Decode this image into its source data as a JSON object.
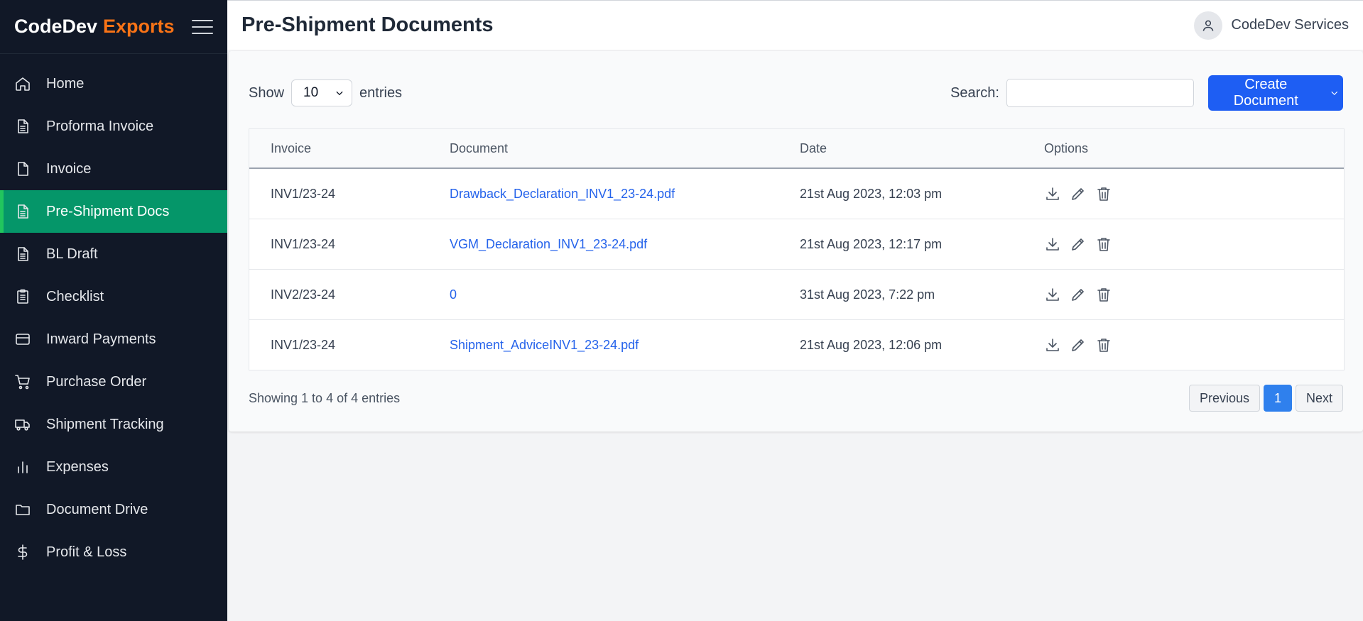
{
  "brand": {
    "name": "CodeDev",
    "accent": "Exports"
  },
  "sidebar": {
    "items": [
      {
        "label": "Home",
        "icon": "home-icon"
      },
      {
        "label": "Proforma Invoice",
        "icon": "document-text-icon"
      },
      {
        "label": "Invoice",
        "icon": "document-icon"
      },
      {
        "label": "Pre-Shipment Docs",
        "icon": "document-text-icon",
        "active": true
      },
      {
        "label": "BL Draft",
        "icon": "document-text-icon"
      },
      {
        "label": "Checklist",
        "icon": "clipboard-icon"
      },
      {
        "label": "Inward Payments",
        "icon": "credit-card-icon"
      },
      {
        "label": "Purchase Order",
        "icon": "cart-icon"
      },
      {
        "label": "Shipment Tracking",
        "icon": "truck-icon"
      },
      {
        "label": "Expenses",
        "icon": "bar-chart-icon"
      },
      {
        "label": "Document Drive",
        "icon": "folder-icon"
      },
      {
        "label": "Profit & Loss",
        "icon": "dollar-icon"
      }
    ]
  },
  "header": {
    "title": "Pre-Shipment Documents",
    "user": "CodeDev Services"
  },
  "toolbar": {
    "show_label": "Show",
    "entries_value": "10",
    "entries_label": "entries",
    "search_label": "Search:",
    "search_value": "",
    "create_label": "Create Document"
  },
  "table": {
    "headers": [
      "Invoice",
      "Document",
      "Date",
      "Options"
    ],
    "rows": [
      {
        "invoice": "INV1/23-24",
        "document": "Drawback_Declaration_INV1_23-24.pdf",
        "date": "21st Aug 2023, 12:03 pm"
      },
      {
        "invoice": "INV1/23-24",
        "document": "VGM_Declaration_INV1_23-24.pdf",
        "date": "21st Aug 2023, 12:17 pm"
      },
      {
        "invoice": "INV2/23-24",
        "document": "0",
        "date": "31st Aug 2023, 7:22 pm"
      },
      {
        "invoice": "INV1/23-24",
        "document": "Shipment_AdviceINV1_23-24.pdf",
        "date": "21st Aug 2023, 12:06 pm"
      }
    ]
  },
  "footer": {
    "showing": "Showing 1 to 4 of 4 entries",
    "previous": "Previous",
    "page": "1",
    "next": "Next"
  },
  "colors": {
    "sidebar_bg": "#111827",
    "active_bg": "#059669",
    "accent": "#f97316",
    "primary": "#1e5ef3",
    "link": "#2563eb"
  }
}
